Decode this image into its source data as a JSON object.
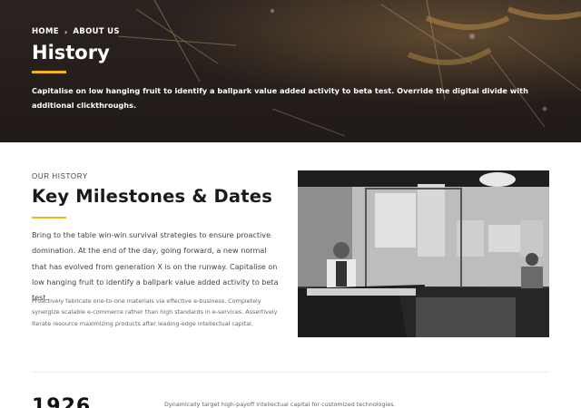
{
  "breadcrumb": {
    "home": "HOME",
    "separator": "›",
    "current": "ABOUT US"
  },
  "hero": {
    "title": "History",
    "description": "Capitalise on low hanging fruit to identify a ballpark value added activity to beta test. Override the digital divide with additional clickthroughs."
  },
  "section": {
    "eyebrow": "OUR HISTORY",
    "title": "Key Milestones & Dates",
    "lead": "Bring to the table win-win survival strategies to ensure proactive domination. At the end of the day, going forward, a new normal that has evolved from generation X is on the runway. Capitalise on low hanging fruit to identify a ballpark value added activity to beta test.",
    "body": "Proactively fabricate one-to-one materials via effective e-business. Completely synergize scalable e-commerce rather than high standards in e-services. Assertively iterate resource maximizing products after leading-edge intellectual capital."
  },
  "timeline": [
    {
      "year": "1926",
      "text": "Dynamically target high-payoff intellectual capital for customized technologies."
    }
  ],
  "colors": {
    "accent": "#f3b418",
    "hero_bg": "#3a2f2b"
  }
}
